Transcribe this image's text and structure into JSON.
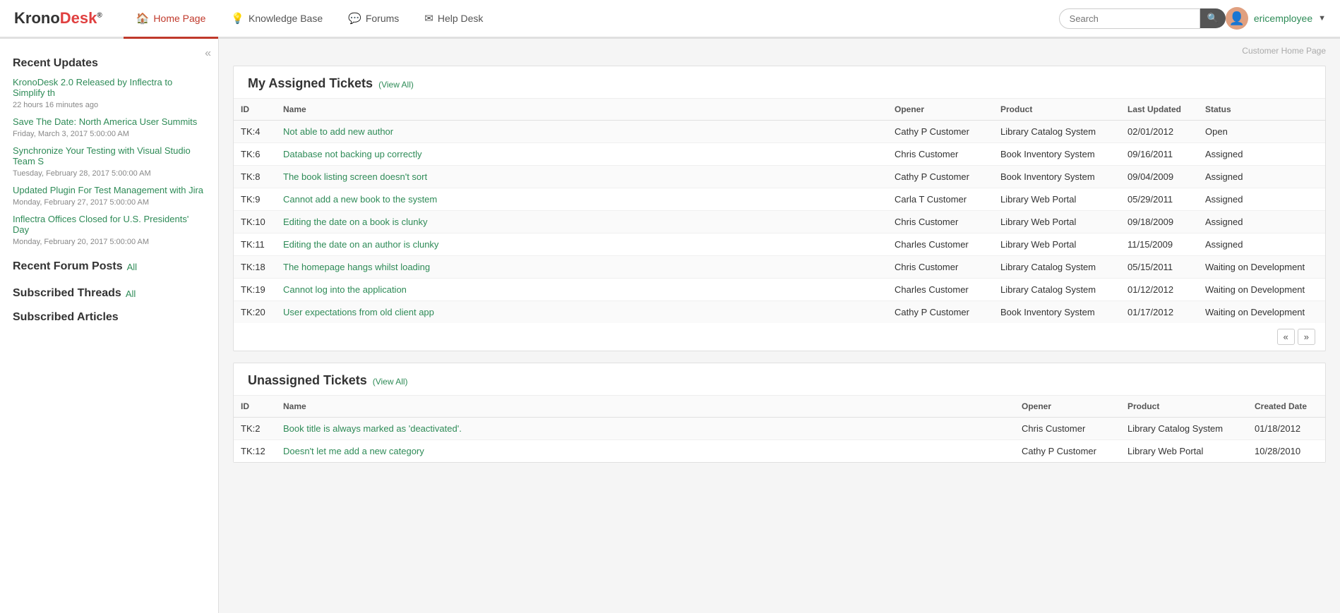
{
  "app": {
    "name": "KronoDesk",
    "logo_part1": "Krono",
    "logo_part2": "Desk",
    "reg": "®"
  },
  "nav": {
    "items": [
      {
        "label": "Home Page",
        "icon": "🏠",
        "active": true
      },
      {
        "label": "Knowledge Base",
        "icon": "💡",
        "active": false
      },
      {
        "label": "Forums",
        "icon": "💬",
        "active": false
      },
      {
        "label": "Help Desk",
        "icon": "✉",
        "active": false
      }
    ]
  },
  "search": {
    "placeholder": "Search",
    "button_icon": "🔍"
  },
  "user": {
    "name": "ericemployee",
    "avatar": "👤"
  },
  "breadcrumb": "Customer Home Page",
  "sidebar": {
    "recent_updates_title": "Recent Updates",
    "updates": [
      {
        "title": "KronoDesk 2.0 Released by Inflectra to Simplify th",
        "time": "22 hours 16 minutes ago"
      },
      {
        "title": "Save The Date: North America User Summits",
        "time": "Friday, March 3, 2017 5:00:00 AM"
      },
      {
        "title": "Synchronize Your Testing with Visual Studio Team S",
        "time": "Tuesday, February 28, 2017 5:00:00 AM"
      },
      {
        "title": "Updated Plugin For Test Management with Jira",
        "time": "Monday, February 27, 2017 5:00:00 AM"
      },
      {
        "title": "Inflectra Offices Closed for U.S. Presidents' Day",
        "time": "Monday, February 20, 2017 5:00:00 AM"
      }
    ],
    "forum_title": "Recent Forum Posts",
    "forum_all": "All",
    "subscribed_threads_title": "Subscribed Threads",
    "subscribed_threads_all": "All",
    "subscribed_articles_title": "Subscribed Articles"
  },
  "assigned_tickets": {
    "title": "My Assigned Tickets",
    "view_all": "(View All)",
    "columns": [
      "ID",
      "Name",
      "Opener",
      "Product",
      "Last Updated",
      "Status"
    ],
    "rows": [
      {
        "id": "TK:4",
        "name": "Not able to add new author",
        "opener": "Cathy P Customer",
        "product": "Library Catalog System",
        "last_updated": "02/01/2012",
        "status": "Open"
      },
      {
        "id": "TK:6",
        "name": "Database not backing up correctly",
        "opener": "Chris Customer",
        "product": "Book Inventory System",
        "last_updated": "09/16/2011",
        "status": "Assigned"
      },
      {
        "id": "TK:8",
        "name": "The book listing screen doesn't sort",
        "opener": "Cathy P Customer",
        "product": "Book Inventory System",
        "last_updated": "09/04/2009",
        "status": "Assigned"
      },
      {
        "id": "TK:9",
        "name": "Cannot add a new book to the system",
        "opener": "Carla T Customer",
        "product": "Library Web Portal",
        "last_updated": "05/29/2011",
        "status": "Assigned"
      },
      {
        "id": "TK:10",
        "name": "Editing the date on a book is clunky",
        "opener": "Chris Customer",
        "product": "Library Web Portal",
        "last_updated": "09/18/2009",
        "status": "Assigned"
      },
      {
        "id": "TK:11",
        "name": "Editing the date on an author is clunky",
        "opener": "Charles Customer",
        "product": "Library Web Portal",
        "last_updated": "11/15/2009",
        "status": "Assigned"
      },
      {
        "id": "TK:18",
        "name": "The homepage hangs whilst loading",
        "opener": "Chris Customer",
        "product": "Library Catalog System",
        "last_updated": "05/15/2011",
        "status": "Waiting on Development"
      },
      {
        "id": "TK:19",
        "name": "Cannot log into the application",
        "opener": "Charles Customer",
        "product": "Library Catalog System",
        "last_updated": "01/12/2012",
        "status": "Waiting on Development"
      },
      {
        "id": "TK:20",
        "name": "User expectations from old client app",
        "opener": "Cathy P Customer",
        "product": "Book Inventory System",
        "last_updated": "01/17/2012",
        "status": "Waiting on Development"
      }
    ]
  },
  "unassigned_tickets": {
    "title": "Unassigned Tickets",
    "view_all": "(View All)",
    "columns": [
      "ID",
      "Name",
      "Opener",
      "Product",
      "Created Date"
    ],
    "rows": [
      {
        "id": "TK:2",
        "name": "Book title is always marked as 'deactivated'.",
        "opener": "Chris Customer",
        "product": "Library Catalog System",
        "created_date": "01/18/2012"
      },
      {
        "id": "TK:12",
        "name": "Doesn't let me add a new category",
        "opener": "Cathy P Customer",
        "product": "Library Web Portal",
        "created_date": "10/28/2010"
      }
    ]
  }
}
